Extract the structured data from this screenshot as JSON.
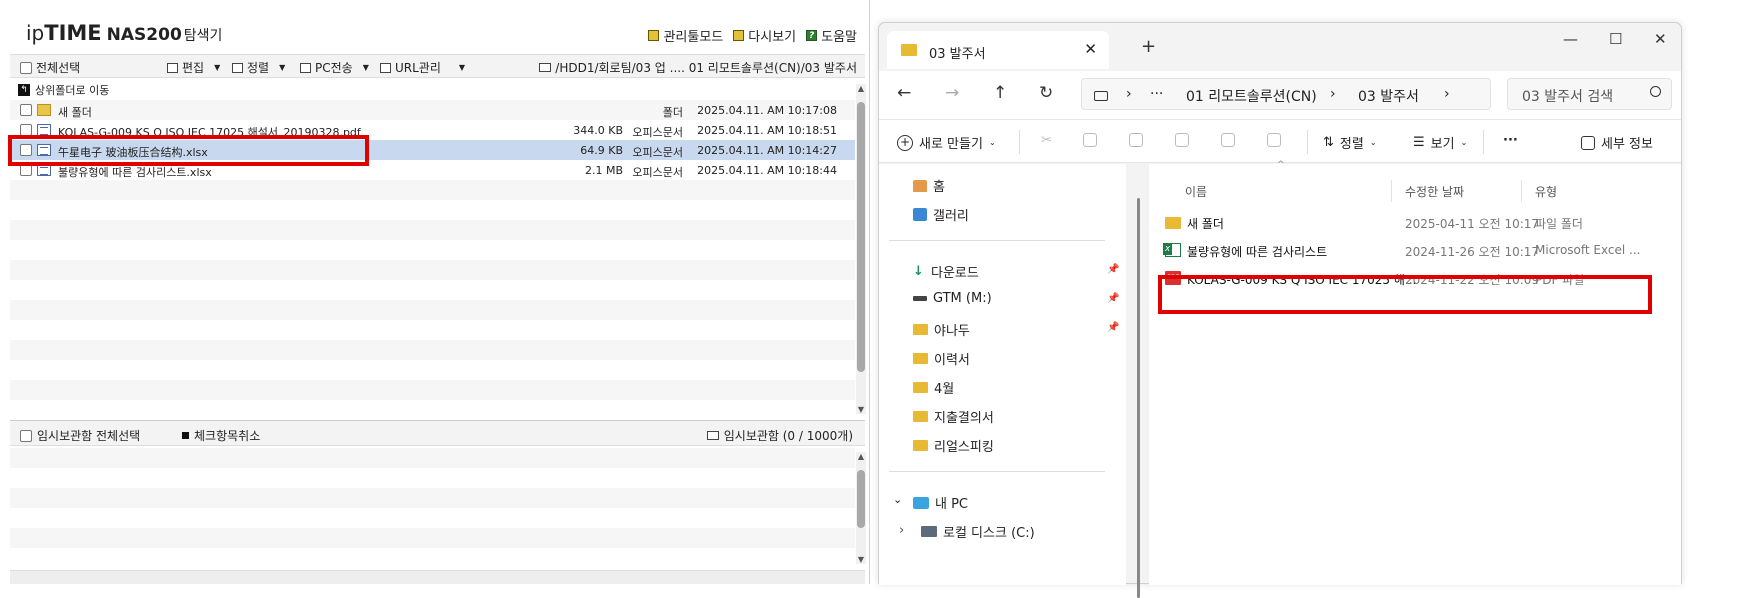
{
  "nas": {
    "logo_ip": "ip",
    "logo_time": "TIME",
    "logo_model": "NAS200",
    "logo_suffix": "탐색기",
    "toplinks": [
      "관리툴모드",
      "다시보기",
      "도움말"
    ],
    "toolbar": {
      "select_all": "전체선택",
      "edit": "편집",
      "sort": "정렬",
      "pc_transfer": "PC전송",
      "url_manage": "URL관리",
      "path": "/HDD1/회로팀/03 업 .... 01 리모트솔루션(CN)/03 발주서"
    },
    "up_folder": "상위폴더로 이동",
    "files": [
      {
        "name": "새 폴더",
        "size": "",
        "type": "폴더",
        "date": "2025.04.11. AM 10:17:08",
        "icon": "folder-icon",
        "selected": false
      },
      {
        "name": "KOLAS-G-009 KS Q ISO IEC 17025 해설서_20190328.pdf",
        "size": "344.0 KB",
        "type": "오피스문서",
        "date": "2025.04.11. AM 10:18:51",
        "icon": "document-icon",
        "selected": false
      },
      {
        "name": "午星电子 玻油板压合结构.xlsx",
        "size": "64.9 KB",
        "type": "오피스문서",
        "date": "2025.04.11. AM 10:14:27",
        "icon": "document-icon",
        "selected": true
      },
      {
        "name": "불량유형에 따른 검사리스트.xlsx",
        "size": "2.1 MB",
        "type": "오피스문서",
        "date": "2025.04.11. AM 10:18:44",
        "icon": "document-icon",
        "selected": false
      }
    ],
    "temp": {
      "select_all": "임시보관함 전체선택",
      "uncheck": "체크항목취소",
      "count_label": "임시보관함 (0 / 1000개)"
    }
  },
  "explorer": {
    "tab_title": "03 발주서",
    "address": {
      "ellipsis": "···",
      "crumb1": "01 리모트솔루션(CN)",
      "crumb2": "03 발주서"
    },
    "search_placeholder": "03 발주서 검색",
    "commands": {
      "new": "새로 만들기",
      "sort": "정렬",
      "view": "보기",
      "more": "···",
      "details": "세부 정보"
    },
    "nav": {
      "home": "홈",
      "gallery": "갤러리",
      "downloads": "다운로드",
      "gtm": "GTM (M:)",
      "yanadu": "야나두",
      "resume": "이력서",
      "april": "4월",
      "expense": "지출결의서",
      "speaking": "리얼스피킹",
      "mypc": "내 PC",
      "localdisk": "로컬 디스크 (C:)"
    },
    "columns": {
      "name": "이름",
      "modified": "수정한 날짜",
      "type": "유형"
    },
    "files": [
      {
        "name": "새 폴더",
        "modified": "2025-04-11 오전 10:17",
        "type": "파일 폴더",
        "icon": "folder-icon"
      },
      {
        "name": "불량유형에 따른 검사리스트",
        "modified": "2024-11-26 오전 10:17",
        "type": "Microsoft Excel ...",
        "icon": "excel-icon"
      },
      {
        "name": "KOLAS-G-009 KS Q ISO IEC 17025 해...",
        "modified": "2024-11-22 오전 10:09",
        "type": "PDF 파일",
        "icon": "pdf-icon"
      }
    ]
  },
  "colors": {
    "highlight_red": "#e00000",
    "selected_row": "#c8d8ee",
    "folder_yellow": "#e8b932"
  }
}
